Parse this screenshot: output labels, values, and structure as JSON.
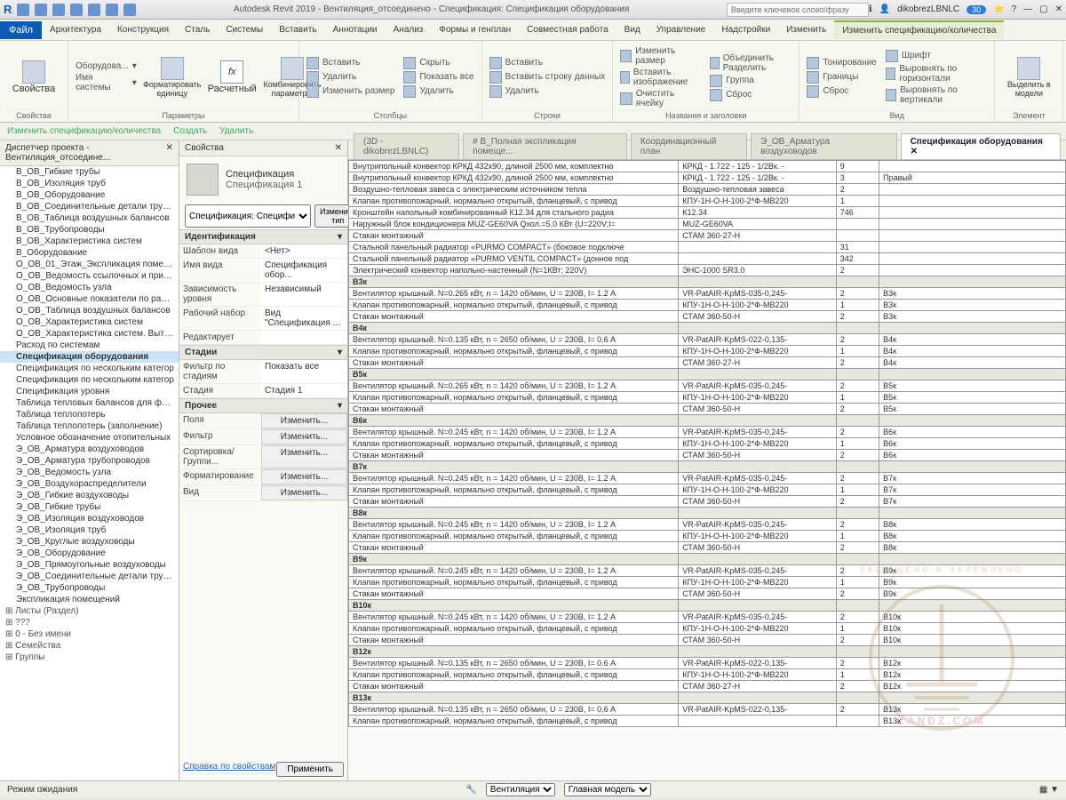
{
  "title": "Autodesk Revit 2019 - Вентиляция_отсоединено - Спецификация: Спецификация оборудования",
  "search_placeholder": "Введите ключевое слово/фразу",
  "user": "dikobrezLBNLC",
  "badge": "30",
  "menu": {
    "file": "Файл",
    "tabs": [
      "Архитектура",
      "Конструкция",
      "Сталь",
      "Системы",
      "Вставить",
      "Аннотации",
      "Анализ",
      "Формы и генплан",
      "Совместная работа",
      "Вид",
      "Управление",
      "Надстройки",
      "Изменить",
      "Изменить спецификацию/количества"
    ]
  },
  "ribbon": {
    "p0": {
      "label": "Свойства",
      "big": "Свойства"
    },
    "p1": {
      "label": "Параметры",
      "c1": "Оборудова...",
      "c2": "Имя системы",
      "big1": "Форматировать единицу",
      "big2": "Расчетный",
      "big3": "Комбинировать параметры"
    },
    "p2": {
      "label": "Столбцы",
      "r1": "Вставить",
      "r2": "Удалить",
      "r3": "Изменить размер"
    },
    "p3": {
      "label": "",
      "r1": "Скрыть",
      "r2": "Показать все",
      "r3": "Удалить"
    },
    "p4": {
      "label": "Строки",
      "r1": "Вставить",
      "r2": "Вставить строку данных",
      "r3": "Удалить"
    },
    "p5": {
      "label": "Названия и заголовки",
      "r1": "Изменить размер",
      "r2": "Вставить изображение",
      "r3": "Очистить ячейку",
      "r4": "Объединить Разделить",
      "r5": "Группа",
      "r6": "Сброс"
    },
    "p6": {
      "label": "Вид",
      "r1": "Тонирование",
      "r2": "Границы",
      "r3": "Сброс",
      "r4": "Шрифт",
      "r5": "Выровнять по горизонтали",
      "r6": "Выровнять по вертикали"
    },
    "p7": {
      "label": "Элемент",
      "big": "Выделить в модели"
    }
  },
  "subbar": {
    "title": "Изменить спецификацию/количества",
    "a": "Создать",
    "b": "Удалить"
  },
  "browser": {
    "title": "Диспетчер проекта - Вентиляция_отсоедине...",
    "items": [
      "В_ОВ_Гибкие трубы",
      "В_ОВ_Изоляция труб",
      "В_ОВ_Оборудование",
      "В_ОВ_Соединительные детали трубопров",
      "В_ОВ_Таблица воздушных балансов",
      "В_ОВ_Трубопроводы",
      "В_ОВ_Характеристика систем",
      "В_Оборудование",
      "О_ОВ_01_Этаж_Экспликация помещен",
      "О_ОВ_Ведомость ссылочных и прилаг",
      "О_ОВ_Ведомость узла",
      "О_ОВ_Основные показатели по рабоч",
      "О_ОВ_Таблица воздушных балансов",
      "О_ОВ_Характеристика систем",
      "О_ОВ_Характеристика систем. Вытяжн",
      "Расход по системам",
      "Спецификация оборудования",
      "Спецификация по нескольким категор",
      "Спецификация по нескольким категор",
      "Спецификация уровня",
      "Таблица тепловых балансов для фанко",
      "Таблица теплопотерь",
      "Таблица теплопотерь (заполнение)",
      "Условное обозначение отопительных",
      "Э_ОВ_Арматура воздуховодов",
      "Э_ОВ_Арматура трубопроводов",
      "Э_ОВ_Ведомость узла",
      "Э_ОВ_Воздухораспределители",
      "Э_ОВ_Гибкие воздуховоды",
      "Э_ОВ_Гибкие трубы",
      "Э_ОВ_Изоляция воздуховодов",
      "Э_ОВ_Изоляция труб",
      "Э_ОВ_Круглые воздуховоды",
      "Э_ОВ_Оборудование",
      "Э_ОВ_Прямоугольные воздуховоды",
      "Э_ОВ_Соединительные детали трубопр",
      "Э_ОВ_Трубопроводы",
      "Экспликация помещений"
    ],
    "cats": [
      "Листы (Раздел)",
      "???",
      "0 - Без имени",
      "Семейства",
      "Группы"
    ],
    "selected": 16
  },
  "props": {
    "title": "Свойства",
    "family": "Спецификация",
    "type": "Спецификация 1",
    "selector": "Спецификация: Специфи",
    "editType": "Изменить тип",
    "sec_id": "Идентификация",
    "rows_id": [
      [
        "Шаблон вида",
        "<Нет>"
      ],
      [
        "Имя вида",
        "Спецификация обор..."
      ],
      [
        "Зависимость уровня",
        "Независимый"
      ],
      [
        "Рабочий набор",
        "Вид \"Спецификация ..."
      ],
      [
        "Редактирует",
        ""
      ]
    ],
    "sec_st": "Стадии",
    "rows_st": [
      [
        "Фильтр по стадиям",
        "Показать все"
      ],
      [
        "Стадия",
        "Стадия 1"
      ]
    ],
    "sec_pr": "Прочее",
    "rows_pr": [
      [
        "Поля",
        "Изменить..."
      ],
      [
        "Фильтр",
        "Изменить..."
      ],
      [
        "Сортировка/Группи...",
        "Изменить..."
      ],
      [
        "Форматирование",
        "Изменить..."
      ],
      [
        "Вид",
        "Изменить..."
      ]
    ],
    "help": "Справка по свойствам",
    "apply": "Применить"
  },
  "doctabs": [
    "(3D - dikobrezLBNLC)",
    "# В_Полная экспликация помеще...",
    "Координационный план",
    "Э_ОВ_Арматура воздуховодов",
    "Спецификация оборудования"
  ],
  "doctab_active": 4,
  "schedule": {
    "rows": [
      [
        "Внутрипольный конвектор КРКД 432х90, длиной 2500 мм, комплектно",
        "КРКД - 1.722 - 125 - 1/2Вк. -",
        "9",
        ""
      ],
      [
        "Внутрипольный конвектор КРКД 432х90, длиной 2500 мм, комплектно",
        "КРКД - 1.722 - 125 - 1/2Вк. -",
        "3",
        "Правый"
      ],
      [
        "Воздушно-тепловая завеса c электрическим источником тепла",
        "Воздушно-тепловая завеса",
        "2",
        ""
      ],
      [
        "Клапан противопожарный, нормально открытый, фланцевый, с привод",
        "КПУ-1Н-О-Н-100-2*Ф-МВ220",
        "1",
        ""
      ],
      [
        "Кронштейн напольный комбинированный К12.34 для стального радиа",
        "К12.34",
        "746",
        ""
      ],
      [
        "Наружный блок кондиционера MUZ-GE60VA Qхол.=5,0 КВт (U=220V;I=",
        "MUZ-GE60VA",
        "",
        ""
      ],
      [
        "Стакан монтажный",
        "СТАМ 360-27-Н",
        "",
        ""
      ],
      [
        "Стальной панельный радиатор «PURMO COMPACT» (боковое подключе",
        "",
        "31",
        ""
      ],
      [
        "Стальной панельный радиатор «PURMO VENTIL COMPACT» (донное под",
        "",
        "342",
        ""
      ],
      [
        "Электрический конвектор напольно-настенный (N=1КВт; 220V)",
        "ЭНС-1000 SR3.0",
        "2",
        ""
      ]
    ],
    "groups": [
      {
        "n": "В3к",
        "items": [
          [
            "Вентилятор крышный. N=0.265 кВт, n = 1420 об/мин, U = 230В, I= 1.2 А",
            "VR-PatAIR-KpMS-035-0,245-",
            "2",
            "В3к"
          ],
          [
            "Клапан противопожарный, нормально открытый, фланцевый, с привод",
            "КПУ-1Н-О-Н-100-2*Ф-МВ220",
            "1",
            "В3к"
          ],
          [
            "Стакан монтажный",
            "СТАМ 360-50-Н",
            "2",
            "В3к"
          ]
        ]
      },
      {
        "n": "В4к",
        "items": [
          [
            "Вентилятор крышный. N=0.135 кВт, n = 2650 об/мин, U = 230В, I= 0.6 А",
            "VR-PatAIR-KpMS-022-0,135-",
            "2",
            "В4к"
          ],
          [
            "Клапан противопожарный, нормально открытый, фланцевый, с привод",
            "КПУ-1Н-О-Н-100-2*Ф-МВ220",
            "1",
            "В4к"
          ],
          [
            "Стакан монтажный",
            "СТАМ 360-27-Н",
            "2",
            "В4к"
          ]
        ]
      },
      {
        "n": "В5к",
        "items": [
          [
            "Вентилятор крышный. N=0.265 кВт, n = 1420 об/мин, U = 230В, I= 1.2 А",
            "VR-PatAIR-KpMS-035-0,245-",
            "2",
            "В5к"
          ],
          [
            "Клапан противопожарный, нормально открытый, фланцевый, с привод",
            "КПУ-1Н-О-Н-100-2*Ф-МВ220",
            "1",
            "В5к"
          ],
          [
            "Стакан монтажный",
            "СТАМ 360-50-Н",
            "2",
            "В5к"
          ]
        ]
      },
      {
        "n": "В6к",
        "items": [
          [
            "Вентилятор крышный. N=0.245 кВт, n = 1420 об/мин, U = 230В, I= 1.2 А",
            "VR-PatAIR-KpMS-035-0,245-",
            "2",
            "В6к"
          ],
          [
            "Клапан противопожарный, нормально открытый, фланцевый, с привод",
            "КПУ-1Н-О-Н-100-2*Ф-МВ220",
            "1",
            "В6к"
          ],
          [
            "Стакан монтажный",
            "СТАМ 360-50-Н",
            "2",
            "В6к"
          ]
        ]
      },
      {
        "n": "В7к",
        "items": [
          [
            "Вентилятор крышный. N=0.245 кВт, n = 1420 об/мин, U = 230В, I= 1.2 А",
            "VR-PatAIR-KpMS-035-0,245-",
            "2",
            "В7к"
          ],
          [
            "Клапан противопожарный, нормально открытый, фланцевый, с привод",
            "КПУ-1Н-О-Н-100-2*Ф-МВ220",
            "1",
            "В7к"
          ],
          [
            "Стакан монтажный",
            "СТАМ 360-50-Н",
            "2",
            "В7к"
          ]
        ]
      },
      {
        "n": "В8к",
        "items": [
          [
            "Вентилятор крышный. N=0.245 кВт, n = 1420 об/мин, U = 230В, I= 1.2 А",
            "VR-PatAIR-KpMS-035-0,245-",
            "2",
            "В8к"
          ],
          [
            "Клапан противопожарный, нормально открытый, фланцевый, с привод",
            "КПУ-1Н-О-Н-100-2*Ф-МВ220",
            "1",
            "В8к"
          ],
          [
            "Стакан монтажный",
            "СТАМ 360-50-Н",
            "2",
            "В8к"
          ]
        ]
      },
      {
        "n": "В9к",
        "items": [
          [
            "Вентилятор крышный. N=0.245 кВт, n = 1420 об/мин, U = 230В, I= 1.2 А",
            "VR-PatAIR-KpMS-035-0,245-",
            "2",
            "В9к"
          ],
          [
            "Клапан противопожарный, нормально открытый, фланцевый, с привод",
            "КПУ-1Н-О-Н-100-2*Ф-МВ220",
            "1",
            "В9к"
          ],
          [
            "Стакан монтажный",
            "СТАМ 360-50-Н",
            "2",
            "В9к"
          ]
        ]
      },
      {
        "n": "В10к",
        "items": [
          [
            "Вентилятор крышный. N=0.245 кВт, n = 1420 об/мин, U = 230В, I= 1.2 А",
            "VR-PatAIR-KpMS-035-0,245-",
            "2",
            "В10к"
          ],
          [
            "Клапан противопожарный, нормально открытый, фланцевый, с привод",
            "КПУ-1Н-О-Н-100-2*Ф-МВ220",
            "1",
            "В10к"
          ],
          [
            "Стакан монтажный",
            "СТАМ 360-50-Н",
            "2",
            "В10к"
          ]
        ]
      },
      {
        "n": "В12к",
        "items": [
          [
            "Вентилятор крышный. N=0.135 кВт, n = 2650 об/мин, U = 230В, I= 0.6 А",
            "VR-PatAIR-KpMS-022-0,135-",
            "2",
            "В12к"
          ],
          [
            "Клапан противопожарный, нормально открытый, фланцевый, с привод",
            "КПУ-1Н-О-Н-100-2*Ф-МВ220",
            "1",
            "В12к"
          ],
          [
            "Стакан монтажный",
            "СТАМ 360-27-Н",
            "2",
            "В12к"
          ]
        ]
      },
      {
        "n": "В13к",
        "items": [
          [
            "Вентилятор крышный. N=0.135 кВт, n = 2650 об/мин, U = 230В, I= 0.6 А",
            "VR-PatAIR-KpMS-022-0,135-",
            "2",
            "В13к"
          ],
          [
            "Клапан противопожарный, нормально открытый, фланцевый, с привод",
            "",
            "",
            "В13к"
          ]
        ]
      }
    ]
  },
  "status": {
    "left": "Режим ожидания",
    "sel1": "Вентиляция",
    "sel2": "Главная модель"
  },
  "watermark": {
    "text1": "ЗАЩИЩЕНО И ЗАЗЕМЛЕНО",
    "text2": "ZANDZ.COM"
  }
}
